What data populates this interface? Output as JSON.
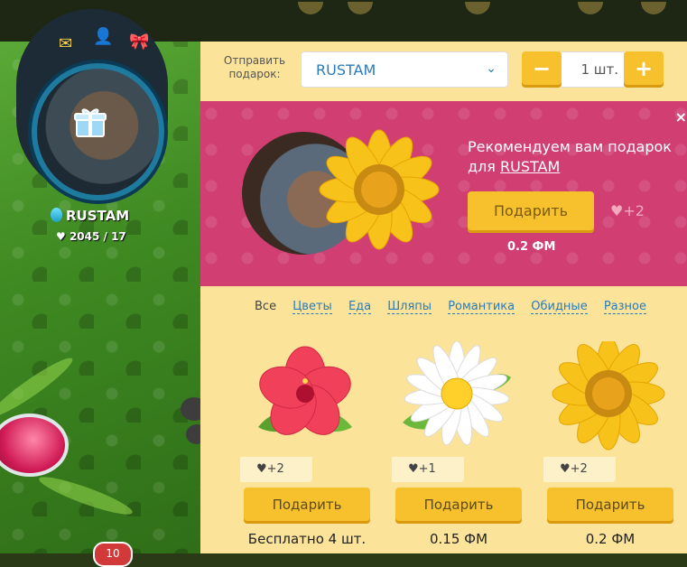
{
  "player": {
    "name": "RUSTAM",
    "stats": "2045 / 17",
    "notification_count": "10"
  },
  "send_bar": {
    "label": "Отправить подарок:",
    "recipient": "RUSTAM",
    "minus": "−",
    "quantity": "1 шт.",
    "plus": "+"
  },
  "recommend": {
    "text_prefix": "Рекомендуем вам подарок для ",
    "recipient_link": "RUSTAM",
    "button": "Подарить",
    "hearts": "+2",
    "price": "0.2 ФМ",
    "close": "×"
  },
  "categories": [
    "Все",
    "Цветы",
    "Еда",
    "Шляпы",
    "Романтика",
    "Обидные",
    "Разное"
  ],
  "gifts": [
    {
      "icon": "hibiscus-flower",
      "hearts": "+2",
      "button": "Подарить",
      "price": "Бесплатно 4 шт."
    },
    {
      "icon": "daisy-flower",
      "hearts": "+1",
      "button": "Подарить",
      "price": "0.15 ФМ"
    },
    {
      "icon": "sunflower",
      "hearts": "+2",
      "button": "Подарить",
      "price": "0.2 ФМ"
    }
  ],
  "colors": {
    "panel": "#fbe39a",
    "recommend": "#d03e72",
    "button": "#f6c12c",
    "link": "#2a7bbd"
  }
}
